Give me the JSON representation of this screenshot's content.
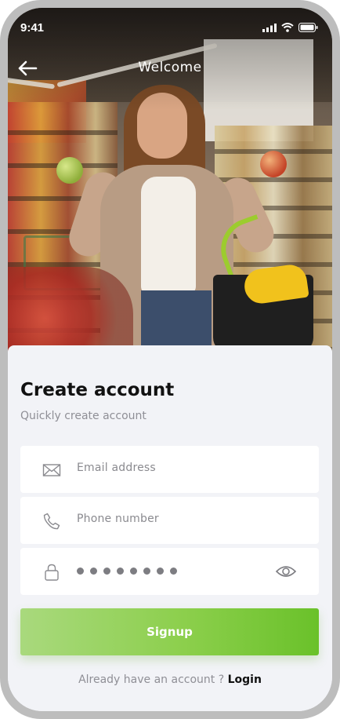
{
  "status_bar": {
    "time": "9:41"
  },
  "nav": {
    "title": "Welcome",
    "back_icon": "arrow-left-icon"
  },
  "form": {
    "title": "Create account",
    "subtitle": "Quickly create account",
    "email": {
      "placeholder": "Email address",
      "icon": "envelope-icon"
    },
    "phone": {
      "placeholder": "Phone number",
      "icon": "phone-icon"
    },
    "password": {
      "masked_length": 8,
      "icon": "lock-icon",
      "toggle_icon": "eye-icon"
    },
    "signup_label": "Signup",
    "login_prompt": "Already have an account ?",
    "login_link": "Login"
  },
  "colors": {
    "accent_start": "#a9d97d",
    "accent_end": "#6ac12a",
    "card_bg": "#f2f3f7",
    "field_bg": "#ffffff",
    "frame": "#bdbdbd"
  }
}
